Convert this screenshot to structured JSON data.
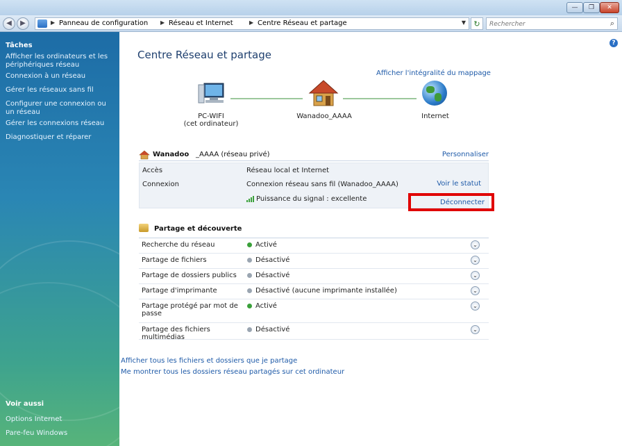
{
  "window": {
    "min_label": "—",
    "max_label": "❐",
    "close_label": "✕"
  },
  "address": {
    "crumbs": [
      "Panneau de configuration",
      "Réseau et Internet",
      "Centre Réseau et partage"
    ],
    "search_placeholder": "Rechercher"
  },
  "sidebar": {
    "tasks_title": "Tâches",
    "tasks": [
      "Afficher les ordinateurs et les périphériques réseau",
      "Connexion à un réseau",
      "Gérer les réseaux sans fil",
      "Configurer une connexion ou un réseau",
      "Gérer les connexions réseau",
      "Diagnostiquer et réparer"
    ],
    "see_also_title": "Voir aussi",
    "see_also": [
      "Options Internet",
      "Pare-feu Windows"
    ]
  },
  "main": {
    "title": "Centre Réseau et partage",
    "full_map_link": "Afficher l'intégralité du mappage",
    "map": {
      "pc_label": "PC-WIFI",
      "pc_sublabel": "(cet ordinateur)",
      "network_label": "Wanadoo_AAAA",
      "internet_label": "Internet"
    },
    "network": {
      "name": "Wanadoo",
      "type": "_AAAA (réseau privé)",
      "customize_link": "Personnaliser",
      "access_label": "Accès",
      "access_value": "Réseau local et Internet",
      "connection_label": "Connexion",
      "connection_value": "Connexion réseau sans fil (Wanadoo_AAAA)",
      "view_status_link": "Voir le statut",
      "signal_value": "Puissance du signal : excellente",
      "disconnect_link": "Déconnecter"
    },
    "sharing": {
      "title": "Partage et découverte",
      "rows": [
        {
          "label": "Recherche du réseau",
          "status": "Activé",
          "color": "#3aa03a"
        },
        {
          "label": "Partage de fichiers",
          "status": "Désactivé",
          "color": "#9aa5b1"
        },
        {
          "label": "Partage de dossiers publics",
          "status": "Désactivé",
          "color": "#9aa5b1"
        },
        {
          "label": "Partage d'imprimante",
          "status": "Désactivé (aucune imprimante installée)",
          "color": "#9aa5b1"
        },
        {
          "label": "Partage protégé par mot de passe",
          "status": "Activé",
          "color": "#3aa03a"
        },
        {
          "label": "Partage des fichiers multimédias",
          "status": "Désactivé",
          "color": "#9aa5b1"
        }
      ],
      "expand_glyph": "⌄"
    },
    "links": {
      "show_shared_files": "Afficher tous les fichiers et dossiers que je partage",
      "show_shared_folders": "Me montrer tous les dossiers réseau partagés sur cet ordinateur"
    }
  },
  "colors": {
    "link": "#1e5aa8",
    "highlight": "#e00000",
    "active_dot": "#3aa03a",
    "inactive_dot": "#9aa5b1"
  }
}
